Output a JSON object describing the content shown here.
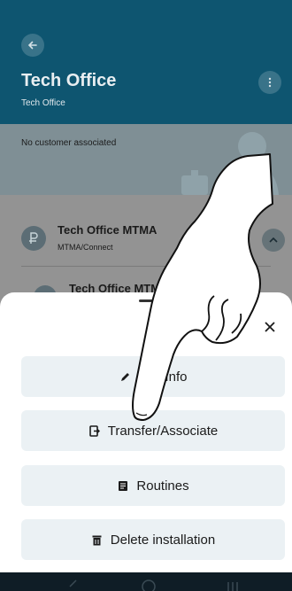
{
  "header": {
    "title": "Tech Office",
    "subtitle": "Tech Office"
  },
  "customer": {
    "text": "No customer associated"
  },
  "devices": [
    {
      "title": "Tech Office MTMA",
      "subtitle": "MTMA/Connect"
    },
    {
      "title": "Tech Office MTMA - Outputs"
    }
  ],
  "sheet": {
    "actions": [
      {
        "label": "Edit Info",
        "icon": "pencil-icon"
      },
      {
        "label": "Transfer/Associate",
        "icon": "transfer-icon"
      },
      {
        "label": "Routines",
        "icon": "routines-icon"
      },
      {
        "label": "Delete installation",
        "icon": "trash-icon"
      }
    ]
  },
  "colors": {
    "header": "#0e5570",
    "sheet": "#ffffff",
    "action_bg": "#ebf1f4",
    "navbar": "#0f1d26"
  }
}
